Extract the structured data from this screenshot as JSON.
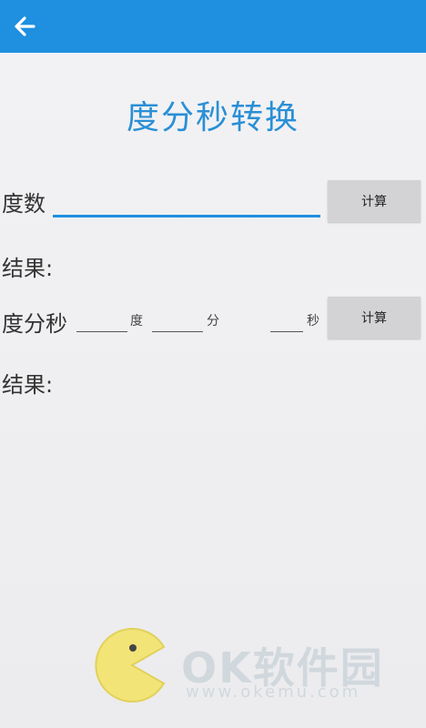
{
  "header": {
    "back_icon": "arrow-left-icon",
    "background_color": "#1f8fe0"
  },
  "main": {
    "title": "度分秒转换",
    "title_color": "#2a8fd6",
    "degrees_label": "度数",
    "degrees_value": "",
    "calc_button_label": "计算",
    "result1_label": "结果:",
    "dms_label": "度分秒",
    "deg_value": "",
    "deg_unit": "度",
    "min_value": "",
    "min_unit": "分",
    "sec_value": "",
    "sec_unit": "秒",
    "calc2_button_label": "计算",
    "result2_label": "结果:"
  },
  "watermark": {
    "text": "OK软件园",
    "url": "www.okemu.com",
    "icon": "pacman-logo-icon"
  }
}
